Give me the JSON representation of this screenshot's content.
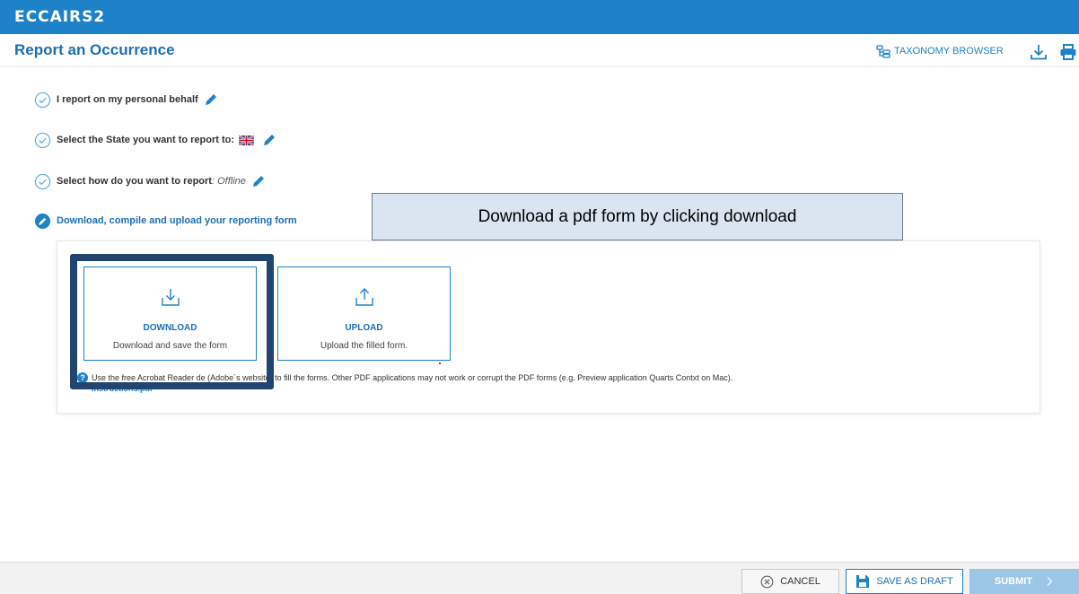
{
  "app": {
    "logo": "ECCAIRS2"
  },
  "header": {
    "title": "Report an Occurrence",
    "taxonomy_label": "TAXONOMY BROWSER",
    "download_icon": "download-icon",
    "print_icon": "print-icon"
  },
  "steps": [
    {
      "label": "I report on my personal behalf",
      "status": "done"
    },
    {
      "label": "Select the State you want to report to:",
      "status": "done",
      "flag": "uk-flag-icon"
    },
    {
      "label": "Select how do you want to report",
      "suffix": ": Offline",
      "status": "done"
    },
    {
      "label": "Download, compile and upload your reporting form",
      "status": "active"
    }
  ],
  "callout": {
    "text": "Download a pdf form by clicking download"
  },
  "cards": {
    "download": {
      "title": "DOWNLOAD",
      "subtitle": "Download and save the form"
    },
    "upload": {
      "title": "UPLOAD",
      "subtitle": "Upload the filled form."
    }
  },
  "info": {
    "text": "Use the free Acrobat Reader de (Adobe´s website) to fill the forms. Other PDF applications may not work or corrupt the PDF forms (e.g. Preview application Quarts Contxt on Mac).",
    "link": "Instructions.pdf"
  },
  "footer": {
    "cancel": "CANCEL",
    "save_draft": "SAVE AS DRAFT",
    "submit": "SUBMIT"
  },
  "colors": {
    "brand": "#1e82c8",
    "title": "#1c6fb3",
    "highlight": "#21456f",
    "callout_bg": "#dbe5f1",
    "submit_disabled": "#9bc6e6"
  }
}
